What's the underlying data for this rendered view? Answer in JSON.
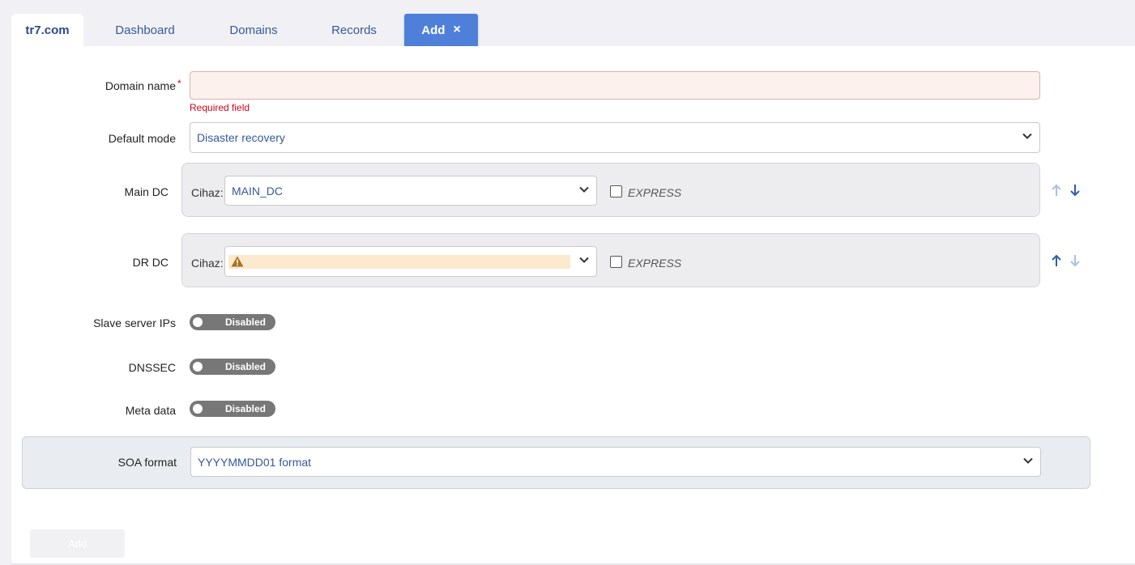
{
  "tabs": {
    "brand": "tr7.com",
    "dashboard": "Dashboard",
    "domains": "Domains",
    "records": "Records",
    "add": "Add",
    "close": "×"
  },
  "form": {
    "domain_name": {
      "label": "Domain name",
      "required_mark": "*",
      "value": "",
      "error": "Required field"
    },
    "default_mode": {
      "label": "Default mode",
      "selected": "Disaster recovery"
    },
    "main_dc": {
      "label": "Main DC",
      "device_label": "Cihaz:",
      "selected": "MAIN_DC",
      "express_label": "EXPRESS",
      "express_checked": false
    },
    "dr_dc": {
      "label": "DR DC",
      "device_label": "Cihaz:",
      "selected": "",
      "express_label": "EXPRESS",
      "express_checked": false
    },
    "slave_server_ips": {
      "label": "Slave server IPs",
      "state": "Disabled"
    },
    "dnssec": {
      "label": "DNSSEC",
      "state": "Disabled"
    },
    "meta_data": {
      "label": "Meta data",
      "state": "Disabled"
    },
    "soa_format": {
      "label": "SOA format",
      "selected": "YYYYMMDD01 format"
    },
    "submit_label": "Add"
  },
  "colors": {
    "accent": "#4f80d9",
    "link": "#35589b",
    "error": "#d0021b",
    "toggle_off": "#777777",
    "warning": "#a6731d"
  }
}
